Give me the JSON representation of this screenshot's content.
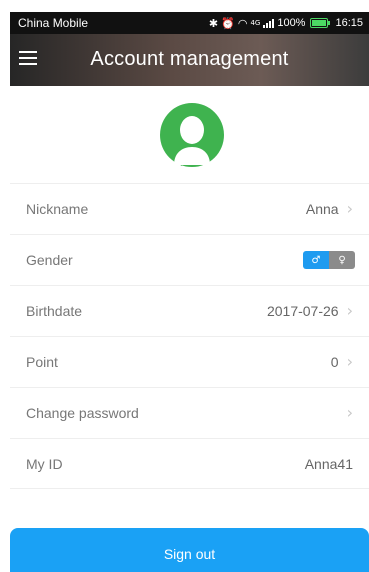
{
  "status_bar": {
    "carrier": "China Mobile",
    "icons": [
      "bluetooth-icon",
      "alarm-icon",
      "wifi-icon",
      "signal-icon"
    ],
    "network": "4G",
    "battery": "100%",
    "battery_level": 1.0,
    "time": "16:15",
    "battery_color": "#4cd964"
  },
  "header": {
    "menu_icon": "hamburger-menu-icon",
    "title": "Account management"
  },
  "avatar": {
    "icon": "user-avatar-icon",
    "color": "#3fb34f"
  },
  "rows": [
    {
      "label": "Nickname",
      "value": "Anna"
    },
    {
      "label": "Gender",
      "male_symbol": "♂",
      "female_symbol": "♀",
      "selected": "male"
    },
    {
      "label": "Birthdate",
      "value": "2017-07-26"
    },
    {
      "label": "Point",
      "value": "0"
    },
    {
      "label": "Change password",
      "value": ""
    },
    {
      "label": "My ID",
      "value": "Anna41"
    }
  ],
  "chevron": "›",
  "sign_out": {
    "label": "Sign out",
    "color": "#1aa1f5"
  },
  "colors": {
    "toggle_male": "#1e9bf0",
    "toggle_female": "#8b8b8b"
  }
}
